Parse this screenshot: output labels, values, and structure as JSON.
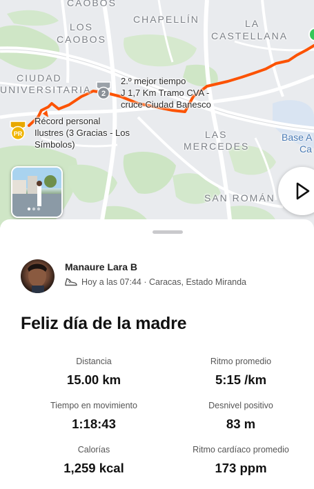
{
  "map": {
    "area_labels": {
      "caobos_top": "CAOBOS",
      "los": "LOS",
      "caobos": "CAOBOS",
      "chapellin": "CHAPELLÍN",
      "la": "LA",
      "castellana": "CASTELLANA",
      "ciudad": "CIUDAD",
      "universitaria": "UNIVERSITARIA",
      "las": "LAS",
      "mercedes": "MERCEDES",
      "san_roman": "SAN ROMÁN",
      "base_a": "Base A",
      "ca": "Ca"
    },
    "callout_segment": {
      "line1": "2.º mejor tiempo",
      "line2": "J 1,7 Km Tramo CVA -",
      "line3": "cruce Ciudad Banesco",
      "badge": "2"
    },
    "callout_pr": {
      "line1": "Récord personal",
      "line2": "Ilustres (3 Gracias - Los",
      "line3": "Símbolos)",
      "badge": "PR"
    },
    "route_color": "#fc5200",
    "photo_icon": "photo-thumbnail",
    "play_icon": "play-triangle-icon"
  },
  "activity": {
    "athlete_name": "Manaure Lara B",
    "activity_icon": "shoe-icon",
    "meta": "Hoy a las 07:44 · Caracas, Estado Miranda",
    "title": "Feliz día de la madre"
  },
  "stats": [
    {
      "label": "Distancia",
      "value": "15.00 km"
    },
    {
      "label": "Ritmo promedio",
      "value": "5:15 /km"
    },
    {
      "label": "Tiempo en movimiento",
      "value": "1:18:43"
    },
    {
      "label": "Desnivel positivo",
      "value": "83 m"
    },
    {
      "label": "Calorías",
      "value": "1,259 kcal"
    },
    {
      "label": "Ritmo cardíaco promedio",
      "value": "173 ppm"
    }
  ]
}
